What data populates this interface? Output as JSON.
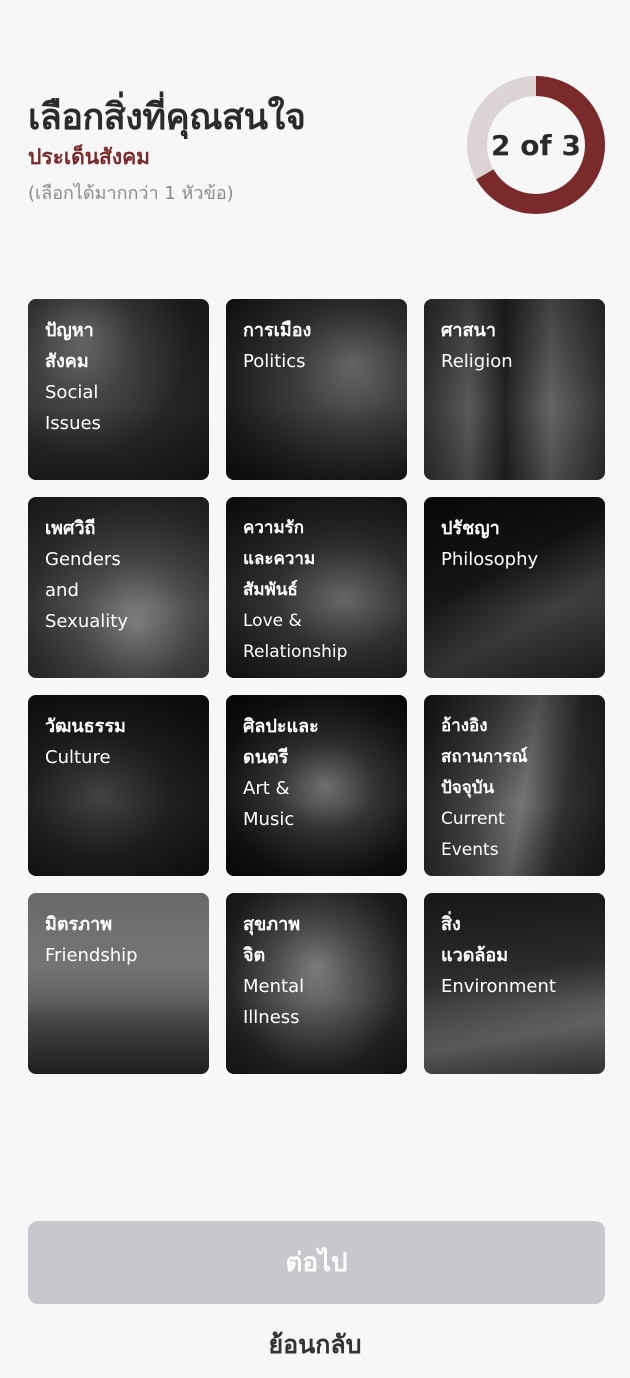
{
  "header": {
    "title": "เลือกสิ่งที่คุณสนใจ",
    "subtitle": "ประเด็นสังคม",
    "hint": "(เลือกได้มากกว่า 1 หัวข้อ)"
  },
  "progress": {
    "label": "2 of 3",
    "current": 2,
    "total": 3,
    "fill_color": "#7a2a2a",
    "track_color": "#dcd4d4"
  },
  "topics": [
    {
      "th": "ปัญหาสังคม",
      "en": "Social Issues"
    },
    {
      "th": "การเมือง",
      "en": "Politics"
    },
    {
      "th": "ศาสนา",
      "en": "Religion"
    },
    {
      "th": "เพศวิถี",
      "en": "Genders and Sexuality"
    },
    {
      "th": "ความรักและความสัมพันธ์",
      "en": "Love & Relationship"
    },
    {
      "th": "ปรัชญา",
      "en": "Philosophy"
    },
    {
      "th": "วัฒนธรรม",
      "en": "Culture"
    },
    {
      "th": "ศิลปะและดนตรี",
      "en": "Art & Music"
    },
    {
      "th": "อ้างอิงสถานการณ์ปัจจุบัน",
      "en": "Current Events"
    },
    {
      "th": "มิตรภาพ",
      "en": "Friendship"
    },
    {
      "th": "สุขภาพจิต",
      "en": "Mental Illness"
    },
    {
      "th": "สิ่งแวดล้อม",
      "en": "Environment"
    }
  ],
  "actions": {
    "next_label": "ต่อไป",
    "back_label": "ย้อนกลับ"
  },
  "colors": {
    "accent": "#7a2a2a",
    "button_disabled": "#c7c7cd",
    "background": "#f7f7f7"
  }
}
